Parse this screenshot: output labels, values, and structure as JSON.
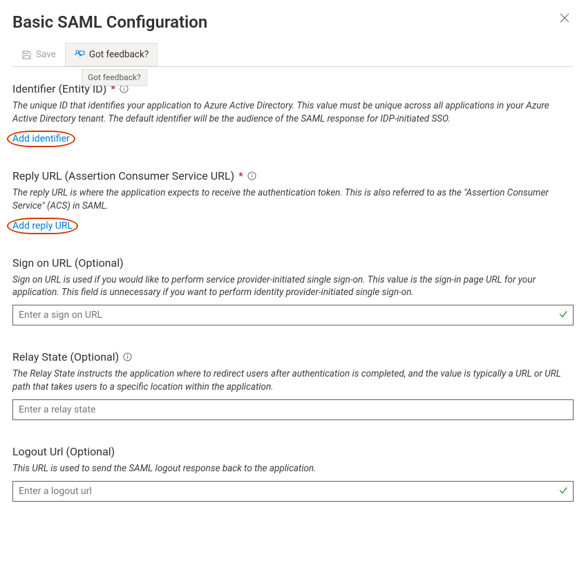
{
  "title": "Basic SAML Configuration",
  "toolbar": {
    "save_label": "Save",
    "feedback_label": "Got feedback?",
    "feedback_tooltip": "Got feedback?"
  },
  "sections": {
    "identifier": {
      "label": "Identifier (Entity ID)",
      "required": true,
      "desc": "The unique ID that identifies your application to Azure Active Directory. This value must be unique across all applications in your Azure Active Directory tenant. The default identifier will be the audience of the SAML response for IDP-initiated SSO.",
      "link": "Add identifier"
    },
    "reply": {
      "label": "Reply URL (Assertion Consumer Service URL)",
      "required": true,
      "desc": "The reply URL is where the application expects to receive the authentication token. This is also referred to as the \"Assertion Consumer Service\" (ACS) in SAML.",
      "link": "Add reply URL"
    },
    "signon": {
      "label": "Sign on URL (Optional)",
      "desc": "Sign on URL is used if you would like to perform service provider-initiated single sign-on. This value is the sign-in page URL for your application. This field is unnecessary if you want to perform identity provider-initiated single sign-on.",
      "placeholder": "Enter a sign on URL"
    },
    "relay": {
      "label": "Relay State (Optional)",
      "desc": "The Relay State instructs the application where to redirect users after authentication is completed, and the value is typically a URL or URL path that takes users to a specific location within the application.",
      "placeholder": "Enter a relay state"
    },
    "logout": {
      "label": "Logout Url (Optional)",
      "desc": "This URL is used to send the SAML logout response back to the application.",
      "placeholder": "Enter a logout url"
    }
  }
}
